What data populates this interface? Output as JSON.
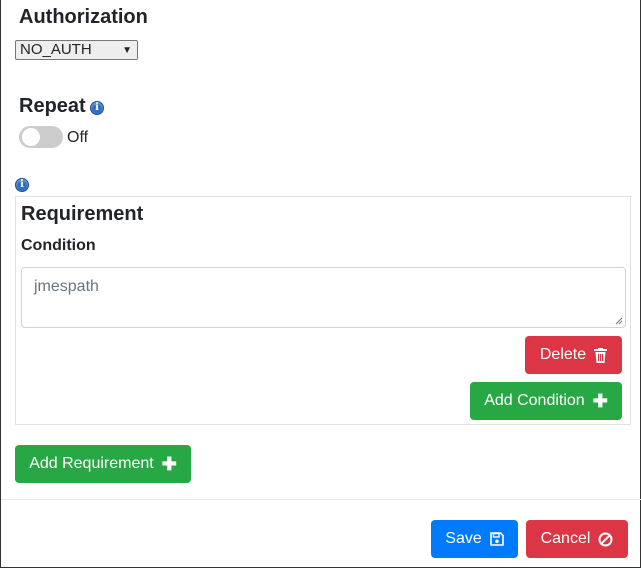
{
  "authorization": {
    "title": "Authorization",
    "selected": "NO_AUTH"
  },
  "repeat": {
    "title": "Repeat",
    "state_label": "Off",
    "enabled": false
  },
  "requirement": {
    "title": "Requirement",
    "condition_label": "Condition",
    "condition_placeholder": "jmespath",
    "delete_label": "Delete",
    "add_condition_label": "Add Condition"
  },
  "add_requirement_label": "Add Requirement",
  "footer": {
    "save_label": "Save",
    "cancel_label": "Cancel"
  },
  "colors": {
    "primary": "#007bff",
    "danger": "#dc3545",
    "success": "#28a745",
    "info": "#2f6fc0"
  }
}
